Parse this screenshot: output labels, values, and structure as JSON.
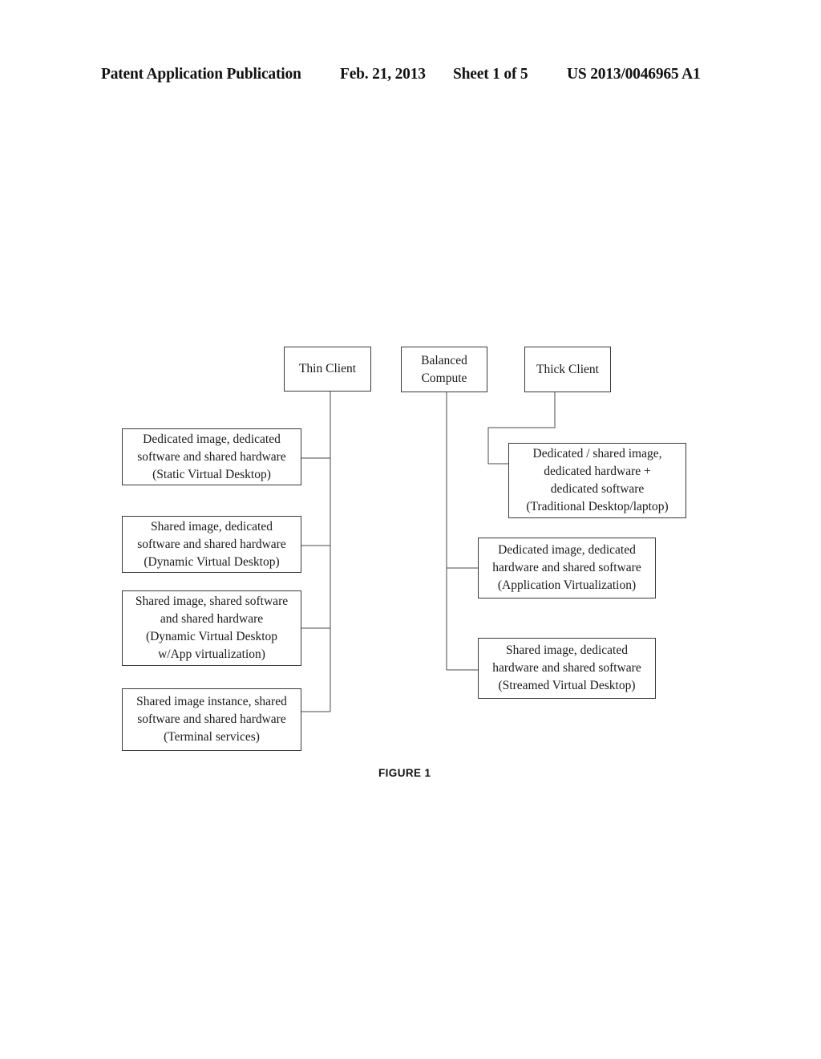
{
  "header": {
    "publication": "Patent Application Publication",
    "date": "Feb. 21, 2013",
    "sheet": "Sheet 1 of 5",
    "number": "US 2013/0046965 A1"
  },
  "figure": {
    "caption": "FIGURE 1"
  },
  "diagram": {
    "top_nodes": [
      {
        "id": "thin-client",
        "lines": [
          "Thin Client"
        ]
      },
      {
        "id": "balanced-compute",
        "lines": [
          "Balanced",
          "Compute"
        ]
      },
      {
        "id": "thick-client",
        "lines": [
          "Thick Client"
        ]
      }
    ],
    "left_nodes": [
      {
        "id": "static-virtual-desktop",
        "lines": [
          "Dedicated image, dedicated",
          "software and shared hardware",
          "(Static Virtual Desktop)"
        ]
      },
      {
        "id": "dynamic-virtual-desktop",
        "lines": [
          "Shared image, dedicated",
          "software and shared hardware",
          "(Dynamic Virtual Desktop)"
        ]
      },
      {
        "id": "dynamic-vd-app-virtualization",
        "lines": [
          "Shared image, shared software",
          "and shared hardware",
          "(Dynamic Virtual Desktop",
          "w/App virtualization)"
        ]
      },
      {
        "id": "terminal-services",
        "lines": [
          "Shared image instance, shared",
          "software and shared hardware",
          "(Terminal services)"
        ]
      }
    ],
    "right_nodes": [
      {
        "id": "traditional-desktop-laptop",
        "lines": [
          "Dedicated / shared image,",
          "dedicated hardware +",
          "dedicated software",
          "(Traditional Desktop/laptop)"
        ]
      },
      {
        "id": "application-virtualization",
        "lines": [
          "Dedicated image, dedicated",
          "hardware and shared software",
          "(Application Virtualization)"
        ]
      },
      {
        "id": "streamed-virtual-desktop",
        "lines": [
          "Shared image, dedicated",
          "hardware and shared software",
          "(Streamed Virtual Desktop)"
        ]
      }
    ],
    "edges": [
      {
        "from": "thin-client",
        "to": "static-virtual-desktop"
      },
      {
        "from": "thin-client",
        "to": "dynamic-virtual-desktop"
      },
      {
        "from": "thin-client",
        "to": "dynamic-vd-app-virtualization"
      },
      {
        "from": "thin-client",
        "to": "terminal-services"
      },
      {
        "from": "balanced-compute",
        "to": "application-virtualization"
      },
      {
        "from": "balanced-compute",
        "to": "streamed-virtual-desktop"
      },
      {
        "from": "thick-client",
        "to": "traditional-desktop-laptop"
      }
    ],
    "line_color": "#4a4a4a"
  }
}
